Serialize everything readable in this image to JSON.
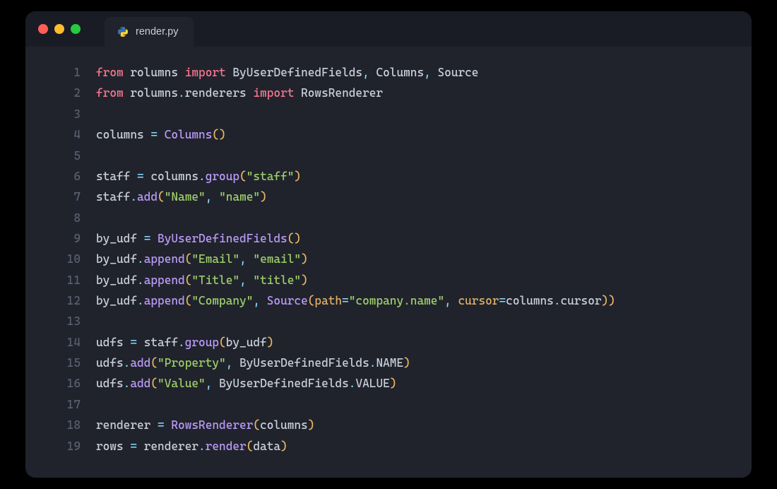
{
  "tab": {
    "filename": "render.py",
    "icon": "python-icon"
  },
  "code": {
    "lines": [
      {
        "n": 1,
        "tokens": [
          {
            "t": "from",
            "c": "kw"
          },
          {
            "t": " ",
            "c": "ident"
          },
          {
            "t": "rolumns",
            "c": "ident"
          },
          {
            "t": " ",
            "c": "ident"
          },
          {
            "t": "import",
            "c": "kw"
          },
          {
            "t": " ",
            "c": "ident"
          },
          {
            "t": "ByUserDefinedFields",
            "c": "ident"
          },
          {
            "t": ",",
            "c": "comma"
          },
          {
            "t": " ",
            "c": "ident"
          },
          {
            "t": "Columns",
            "c": "ident"
          },
          {
            "t": ",",
            "c": "comma"
          },
          {
            "t": " ",
            "c": "ident"
          },
          {
            "t": "Source",
            "c": "ident"
          }
        ]
      },
      {
        "n": 2,
        "tokens": [
          {
            "t": "from",
            "c": "kw"
          },
          {
            "t": " ",
            "c": "ident"
          },
          {
            "t": "rolumns",
            "c": "ident"
          },
          {
            "t": ".",
            "c": "dot"
          },
          {
            "t": "renderers",
            "c": "ident"
          },
          {
            "t": " ",
            "c": "ident"
          },
          {
            "t": "import",
            "c": "kw"
          },
          {
            "t": " ",
            "c": "ident"
          },
          {
            "t": "RowsRenderer",
            "c": "ident"
          }
        ]
      },
      {
        "n": 3,
        "tokens": []
      },
      {
        "n": 4,
        "tokens": [
          {
            "t": "columns",
            "c": "ident"
          },
          {
            "t": " ",
            "c": "ident"
          },
          {
            "t": "=",
            "c": "op"
          },
          {
            "t": " ",
            "c": "ident"
          },
          {
            "t": "Columns",
            "c": "fn"
          },
          {
            "t": "()",
            "c": "paren"
          }
        ]
      },
      {
        "n": 5,
        "tokens": []
      },
      {
        "n": 6,
        "tokens": [
          {
            "t": "staff",
            "c": "ident"
          },
          {
            "t": " ",
            "c": "ident"
          },
          {
            "t": "=",
            "c": "op"
          },
          {
            "t": " ",
            "c": "ident"
          },
          {
            "t": "columns",
            "c": "ident"
          },
          {
            "t": ".",
            "c": "dot"
          },
          {
            "t": "group",
            "c": "fn"
          },
          {
            "t": "(",
            "c": "paren"
          },
          {
            "t": "\"staff\"",
            "c": "str"
          },
          {
            "t": ")",
            "c": "paren"
          }
        ]
      },
      {
        "n": 7,
        "tokens": [
          {
            "t": "staff",
            "c": "ident"
          },
          {
            "t": ".",
            "c": "dot"
          },
          {
            "t": "add",
            "c": "fn"
          },
          {
            "t": "(",
            "c": "paren"
          },
          {
            "t": "\"Name\"",
            "c": "str"
          },
          {
            "t": ",",
            "c": "comma"
          },
          {
            "t": " ",
            "c": "ident"
          },
          {
            "t": "\"name\"",
            "c": "str"
          },
          {
            "t": ")",
            "c": "paren"
          }
        ]
      },
      {
        "n": 8,
        "tokens": []
      },
      {
        "n": 9,
        "tokens": [
          {
            "t": "by_udf",
            "c": "ident"
          },
          {
            "t": " ",
            "c": "ident"
          },
          {
            "t": "=",
            "c": "op"
          },
          {
            "t": " ",
            "c": "ident"
          },
          {
            "t": "ByUserDefinedFields",
            "c": "fn"
          },
          {
            "t": "()",
            "c": "paren"
          }
        ]
      },
      {
        "n": 10,
        "tokens": [
          {
            "t": "by_udf",
            "c": "ident"
          },
          {
            "t": ".",
            "c": "dot"
          },
          {
            "t": "append",
            "c": "fn"
          },
          {
            "t": "(",
            "c": "paren"
          },
          {
            "t": "\"Email\"",
            "c": "str"
          },
          {
            "t": ",",
            "c": "comma"
          },
          {
            "t": " ",
            "c": "ident"
          },
          {
            "t": "\"email\"",
            "c": "str"
          },
          {
            "t": ")",
            "c": "paren"
          }
        ]
      },
      {
        "n": 11,
        "tokens": [
          {
            "t": "by_udf",
            "c": "ident"
          },
          {
            "t": ".",
            "c": "dot"
          },
          {
            "t": "append",
            "c": "fn"
          },
          {
            "t": "(",
            "c": "paren"
          },
          {
            "t": "\"Title\"",
            "c": "str"
          },
          {
            "t": ",",
            "c": "comma"
          },
          {
            "t": " ",
            "c": "ident"
          },
          {
            "t": "\"title\"",
            "c": "str"
          },
          {
            "t": ")",
            "c": "paren"
          }
        ]
      },
      {
        "n": 12,
        "tokens": [
          {
            "t": "by_udf",
            "c": "ident"
          },
          {
            "t": ".",
            "c": "dot"
          },
          {
            "t": "append",
            "c": "fn"
          },
          {
            "t": "(",
            "c": "paren"
          },
          {
            "t": "\"Company\"",
            "c": "str"
          },
          {
            "t": ",",
            "c": "comma"
          },
          {
            "t": " ",
            "c": "ident"
          },
          {
            "t": "Source",
            "c": "fn"
          },
          {
            "t": "(",
            "c": "paren"
          },
          {
            "t": "path",
            "c": "param"
          },
          {
            "t": "=",
            "c": "op"
          },
          {
            "t": "\"company.name\"",
            "c": "str"
          },
          {
            "t": ",",
            "c": "comma"
          },
          {
            "t": " ",
            "c": "ident"
          },
          {
            "t": "cursor",
            "c": "param"
          },
          {
            "t": "=",
            "c": "op"
          },
          {
            "t": "columns",
            "c": "ident"
          },
          {
            "t": ".",
            "c": "dot"
          },
          {
            "t": "cursor",
            "c": "ident"
          },
          {
            "t": "))",
            "c": "paren"
          }
        ]
      },
      {
        "n": 13,
        "tokens": []
      },
      {
        "n": 14,
        "tokens": [
          {
            "t": "udfs",
            "c": "ident"
          },
          {
            "t": " ",
            "c": "ident"
          },
          {
            "t": "=",
            "c": "op"
          },
          {
            "t": " ",
            "c": "ident"
          },
          {
            "t": "staff",
            "c": "ident"
          },
          {
            "t": ".",
            "c": "dot"
          },
          {
            "t": "group",
            "c": "fn"
          },
          {
            "t": "(",
            "c": "paren"
          },
          {
            "t": "by_udf",
            "c": "ident"
          },
          {
            "t": ")",
            "c": "paren"
          }
        ]
      },
      {
        "n": 15,
        "tokens": [
          {
            "t": "udfs",
            "c": "ident"
          },
          {
            "t": ".",
            "c": "dot"
          },
          {
            "t": "add",
            "c": "fn"
          },
          {
            "t": "(",
            "c": "paren"
          },
          {
            "t": "\"Property\"",
            "c": "str"
          },
          {
            "t": ",",
            "c": "comma"
          },
          {
            "t": " ",
            "c": "ident"
          },
          {
            "t": "ByUserDefinedFields",
            "c": "ident"
          },
          {
            "t": ".",
            "c": "dot"
          },
          {
            "t": "NAME",
            "c": "const"
          },
          {
            "t": ")",
            "c": "paren"
          }
        ]
      },
      {
        "n": 16,
        "tokens": [
          {
            "t": "udfs",
            "c": "ident"
          },
          {
            "t": ".",
            "c": "dot"
          },
          {
            "t": "add",
            "c": "fn"
          },
          {
            "t": "(",
            "c": "paren"
          },
          {
            "t": "\"Value\"",
            "c": "str"
          },
          {
            "t": ",",
            "c": "comma"
          },
          {
            "t": " ",
            "c": "ident"
          },
          {
            "t": "ByUserDefinedFields",
            "c": "ident"
          },
          {
            "t": ".",
            "c": "dot"
          },
          {
            "t": "VALUE",
            "c": "const"
          },
          {
            "t": ")",
            "c": "paren"
          }
        ]
      },
      {
        "n": 17,
        "tokens": []
      },
      {
        "n": 18,
        "tokens": [
          {
            "t": "renderer",
            "c": "ident"
          },
          {
            "t": " ",
            "c": "ident"
          },
          {
            "t": "=",
            "c": "op"
          },
          {
            "t": " ",
            "c": "ident"
          },
          {
            "t": "RowsRenderer",
            "c": "fn"
          },
          {
            "t": "(",
            "c": "paren"
          },
          {
            "t": "columns",
            "c": "ident"
          },
          {
            "t": ")",
            "c": "paren"
          }
        ]
      },
      {
        "n": 19,
        "tokens": [
          {
            "t": "rows",
            "c": "ident"
          },
          {
            "t": " ",
            "c": "ident"
          },
          {
            "t": "=",
            "c": "op"
          },
          {
            "t": " ",
            "c": "ident"
          },
          {
            "t": "renderer",
            "c": "ident"
          },
          {
            "t": ".",
            "c": "dot"
          },
          {
            "t": "render",
            "c": "fn"
          },
          {
            "t": "(",
            "c": "paren"
          },
          {
            "t": "data",
            "c": "ident"
          },
          {
            "t": ")",
            "c": "paren"
          }
        ]
      }
    ]
  }
}
